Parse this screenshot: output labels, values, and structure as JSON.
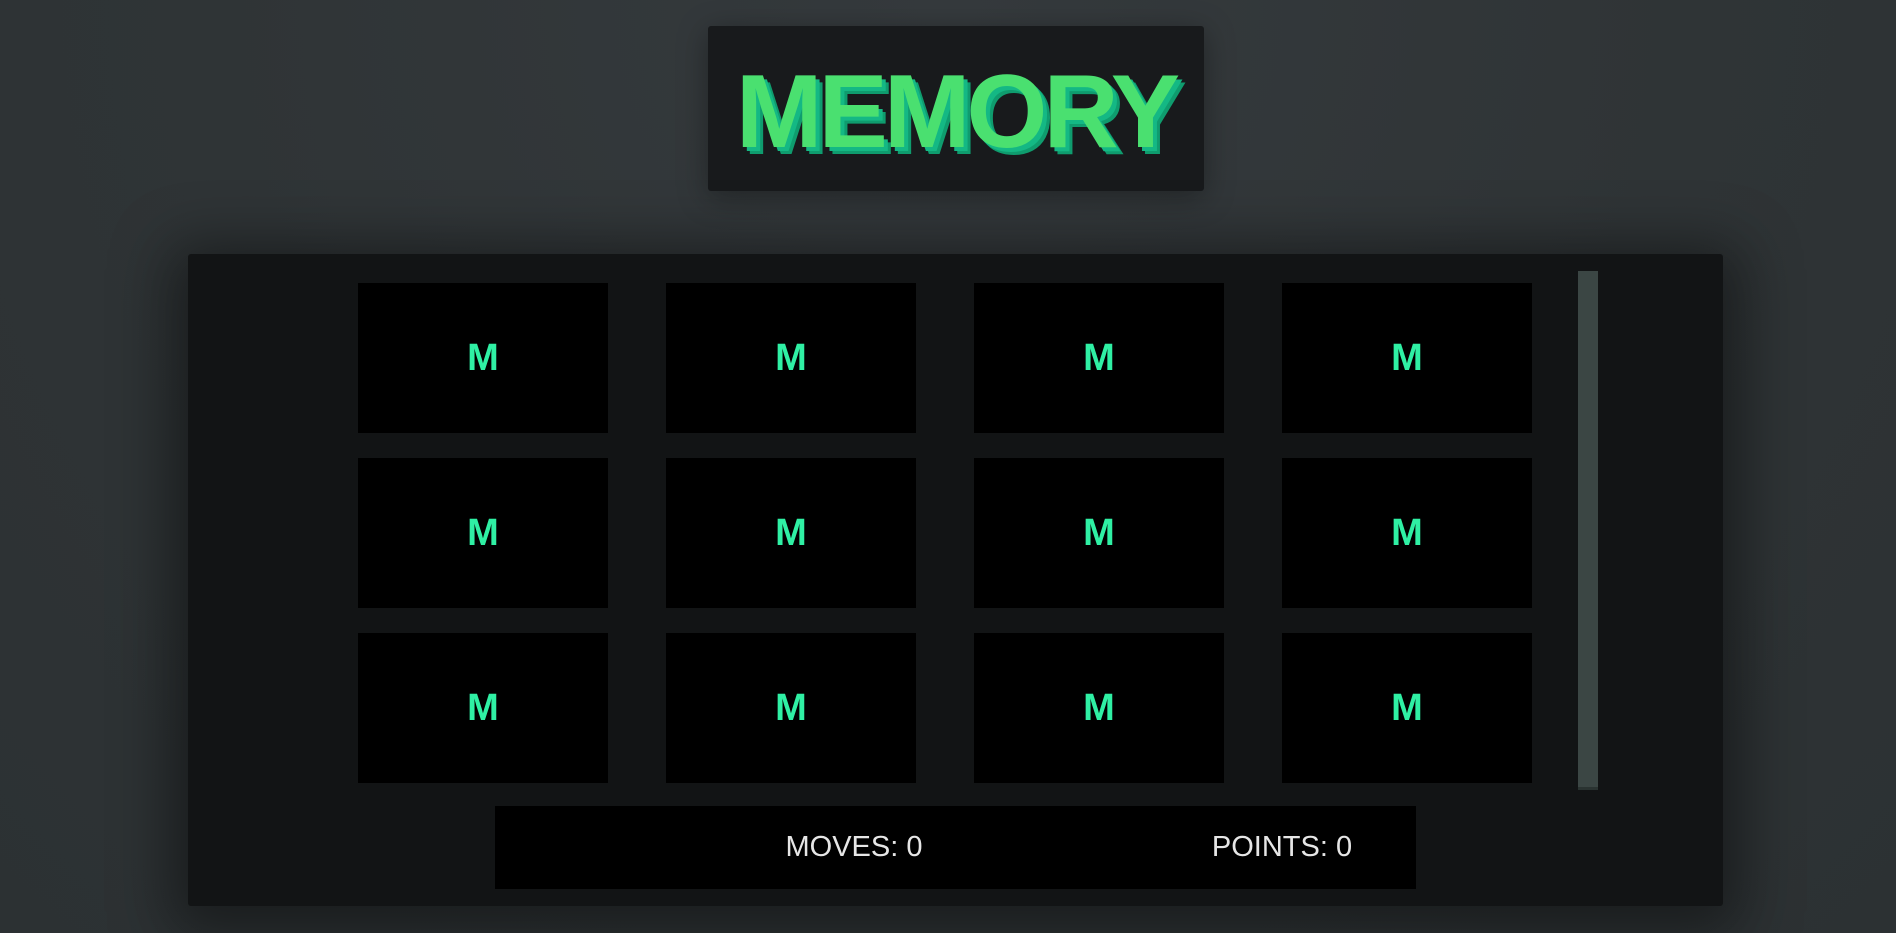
{
  "header": {
    "title": "MEMORY"
  },
  "board": {
    "rows": 3,
    "cols": 4,
    "cards": [
      {
        "face": "M"
      },
      {
        "face": "M"
      },
      {
        "face": "M"
      },
      {
        "face": "M"
      },
      {
        "face": "M"
      },
      {
        "face": "M"
      },
      {
        "face": "M"
      },
      {
        "face": "M"
      },
      {
        "face": "M"
      },
      {
        "face": "M"
      },
      {
        "face": "M"
      },
      {
        "face": "M"
      }
    ]
  },
  "status": {
    "moves_label": "MOVES:",
    "moves_value": "0",
    "points_label": "POINTS:",
    "points_value": "0"
  },
  "colors": {
    "title_green": "#4ae070",
    "title_shadow": "#14b884",
    "card_letter": "#2ff0a4",
    "card_back": "#000000",
    "board_bg": "#121415",
    "page_bg": "#2f3436"
  }
}
